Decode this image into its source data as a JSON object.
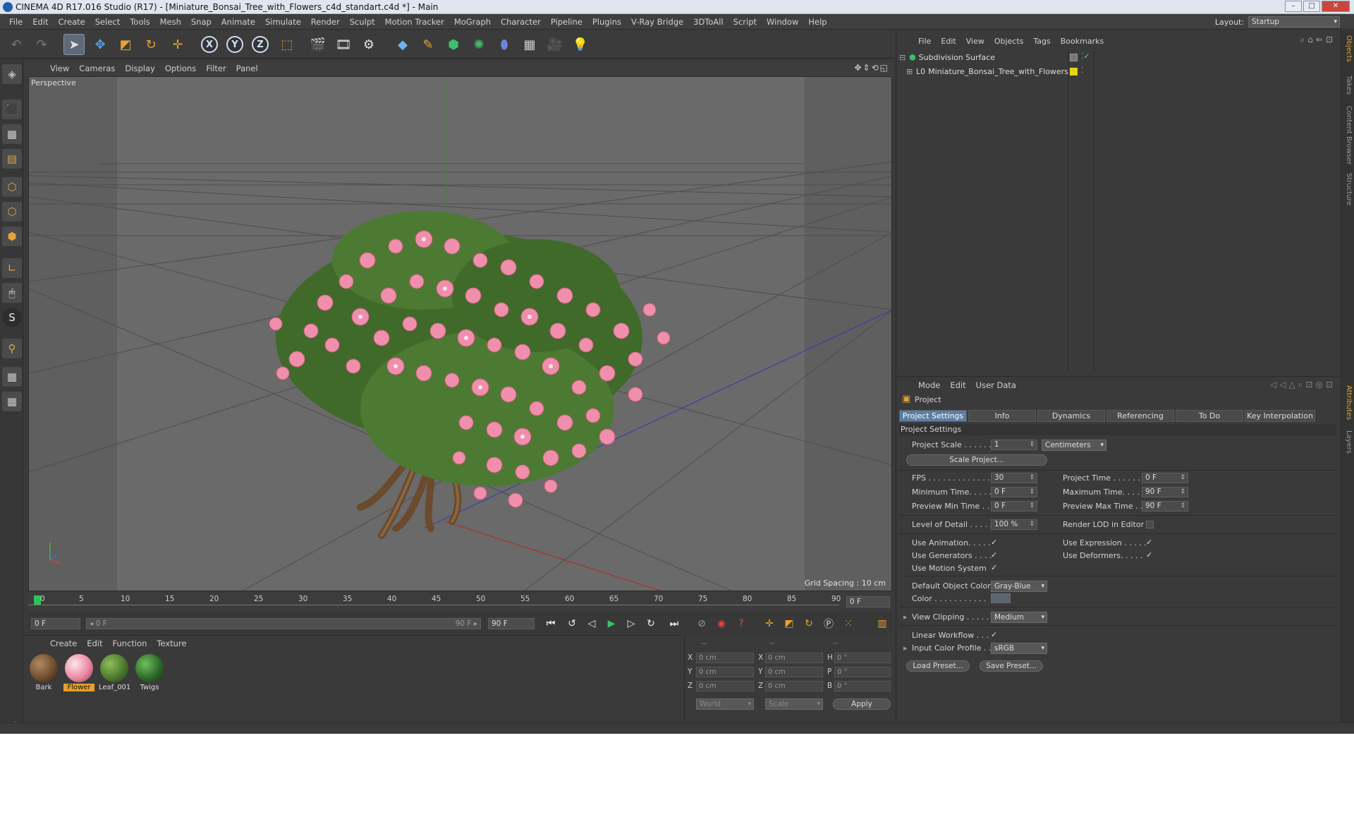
{
  "window": {
    "title": "CINEMA 4D R17.016 Studio (R17) - [Miniature_Bonsai_Tree_with_Flowers_c4d_standart.c4d *] - Main"
  },
  "menubar": {
    "items": [
      "File",
      "Edit",
      "Create",
      "Select",
      "Tools",
      "Mesh",
      "Snap",
      "Animate",
      "Simulate",
      "Render",
      "Sculpt",
      "Motion Tracker",
      "MoGraph",
      "Character",
      "Pipeline",
      "Plugins",
      "V-Ray Bridge",
      "3DToAll",
      "Script",
      "Window",
      "Help"
    ],
    "layout_label": "Layout:",
    "layout_value": "Startup"
  },
  "viewport": {
    "menu": [
      "View",
      "Cameras",
      "Display",
      "Options",
      "Filter",
      "Panel"
    ],
    "label": "Perspective",
    "grid_spacing": "Grid Spacing : 10 cm"
  },
  "timeline": {
    "ticks": [
      "0",
      "5",
      "10",
      "15",
      "20",
      "25",
      "30",
      "35",
      "40",
      "45",
      "50",
      "55",
      "60",
      "65",
      "70",
      "75",
      "80",
      "85",
      "90"
    ],
    "current_frame": "0 F",
    "start_field": "0 F",
    "range_start": "◂ 0 F",
    "range_end": "90 F ▸",
    "end_field": "90 F"
  },
  "materials": {
    "menu": [
      "Create",
      "Edit",
      "Function",
      "Texture"
    ],
    "items": [
      {
        "name": "Bark",
        "color": "#6b4a2b",
        "selected": false
      },
      {
        "name": "Flower",
        "color": "#e98aa2",
        "selected": true
      },
      {
        "name": "Leaf_001",
        "color": "#4d7a2e",
        "selected": false
      },
      {
        "name": "Twigs",
        "color": "#2f6b2a",
        "selected": false
      }
    ]
  },
  "coordinates": {
    "header": [
      "--",
      "--",
      "--"
    ],
    "rows": [
      {
        "a": "X",
        "av": "0 cm",
        "b": "X",
        "bv": "0 cm",
        "c": "H",
        "cv": "0 °"
      },
      {
        "a": "Y",
        "av": "0 cm",
        "b": "Y",
        "bv": "0 cm",
        "c": "P",
        "cv": "0 °"
      },
      {
        "a": "Z",
        "av": "0 cm",
        "b": "Z",
        "bv": "0 cm",
        "c": "B",
        "cv": "0 °"
      }
    ],
    "world": "World",
    "scale": "Scale",
    "apply": "Apply"
  },
  "object_manager": {
    "menu": [
      "File",
      "Edit",
      "View",
      "Objects",
      "Tags",
      "Bookmarks"
    ],
    "objects": [
      {
        "name": "Subdivision Surface"
      },
      {
        "name": "Miniature_Bonsai_Tree_with_Flowers"
      }
    ]
  },
  "attributes": {
    "menu": [
      "Mode",
      "Edit",
      "User Data"
    ],
    "title": "Project",
    "tabs": [
      "Project Settings",
      "Info",
      "Dynamics",
      "Referencing",
      "To Do",
      "Key Interpolation"
    ],
    "section": "Project Settings",
    "project_scale_label": "Project Scale . . . . . .",
    "project_scale_value": "1",
    "project_scale_unit": "Centimeters",
    "scale_project_btn": "Scale Project...",
    "fps_label": "FPS . . . . . . . . . . . . . .",
    "fps_value": "30",
    "project_time_label": "Project Time . . . . . . .",
    "project_time_value": "0 F",
    "min_time_label": "Minimum Time. . . . . .",
    "min_time_value": "0 F",
    "max_time_label": "Maximum Time. . . . . .",
    "max_time_value": "90 F",
    "prev_min_label": "Preview Min Time . . .",
    "prev_min_value": "0 F",
    "prev_max_label": "Preview Max Time . . .",
    "prev_max_value": "90 F",
    "lod_label": "Level of Detail . . . . .",
    "lod_value": "100 %",
    "render_lod_label": "Render LOD in Editor",
    "use_animation_label": "Use Animation. . . . .",
    "use_expression_label": "Use Expression . . . . .",
    "use_generators_label": "Use Generators . . . .",
    "use_deformers_label": "Use Deformers. . . . .",
    "use_motion_label": "Use Motion System",
    "default_color_label": "Default Object Color",
    "default_color_value": "Gray-Blue",
    "color_label": "Color . . . . . . . . . . .",
    "view_clipping_label": "View Clipping . . . . .",
    "view_clipping_value": "Medium",
    "linear_workflow_label": "Linear Workflow . . .",
    "input_profile_label": "Input Color Profile . .",
    "input_profile_value": "sRGB",
    "load_preset": "Load Preset...",
    "save_preset": "Save Preset..."
  },
  "right_tabs": [
    "Objects",
    "Takes",
    "Content Browser",
    "Structure",
    "Attributes",
    "Layers"
  ]
}
